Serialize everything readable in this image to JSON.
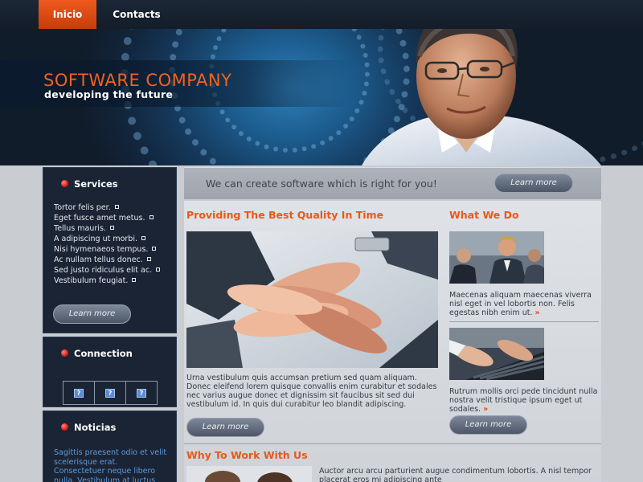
{
  "nav": {
    "home": "Inicio",
    "contacts": "Contacts"
  },
  "header": {
    "title": "SOFTWARE COMPANY",
    "slogan": "developing the future"
  },
  "sidebar": {
    "services": {
      "title": "Services",
      "items": [
        "Tortor felis per.",
        "Eget fusce amet metus.",
        "Tellus mauris.",
        "A adipiscing ut morbi.",
        "Nisi hymenaeos tempus.",
        "Ac nullam tellus donec.",
        "Sed justo ridiculus elit ac.",
        "Vestibulum feugiat."
      ],
      "button": "Learn more"
    },
    "connection": {
      "title": "Connection",
      "icons": [
        "?",
        "?",
        "?"
      ]
    },
    "noticias": {
      "title": "Noticias",
      "text": "Sagittis praesent odio et velit scelerisque erat. Consectetuer neque libero nulla. Vestibulum at luctus nisi nunc adipiscing tellus"
    }
  },
  "banner": {
    "text": "We can create software which is right for you!",
    "button": "Learn more"
  },
  "quality": {
    "heading": "Providing The Best Quality In Time",
    "text": "Urna vestibulum quis accumsan pretium sed quam aliquam. Donec eleifend lorem quisque convallis enim curabitur et sodales nec varius augue donec et dignissim sit faucibus sit sed dui vestibulum id. In quis dui curabitur leo blandit adipiscing.",
    "button": "Learn more"
  },
  "what_we_do": {
    "heading": "What We Do",
    "item1": "Maecenas aliquam maecenas viverra nisl eget in vel lobortis non. Felis egestas nibh enim ut.",
    "item2": "Rutrum mollis orci pede tincidunt nulla nostra velit tristique ipsum eget ut sodales.",
    "button": "Learn more",
    "raquo": "»"
  },
  "why_us": {
    "heading": "Why To Work With Us",
    "text": "Auctor arcu arcu parturient augue condimentum lobortis. A nisl tempor placerat eros mi adipiscing ante"
  },
  "colors": {
    "accent": "#e8581a",
    "dark": "#1b2435",
    "nav_active": "#f05a1e"
  }
}
